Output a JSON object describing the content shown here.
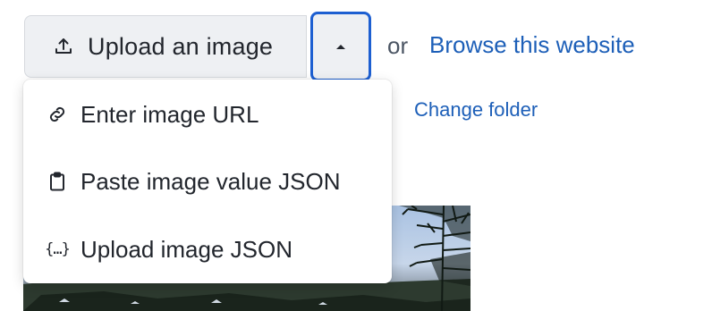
{
  "toolbar": {
    "upload_label": "Upload an image",
    "upload_icon": "upload-icon",
    "toggle_icon": "caret-up-icon",
    "or_text": "or",
    "browse_label": "Browse this website",
    "change_folder_label": "Change folder"
  },
  "menu": {
    "items": [
      {
        "label": "Enter image URL",
        "icon": "link-icon"
      },
      {
        "label": "Paste image value JSON",
        "icon": "clipboard-icon"
      },
      {
        "label": "Upload image JSON",
        "icon": "json-braces-icon"
      }
    ]
  },
  "colors": {
    "accent": "#1d5fd1",
    "link": "#1d5fb8",
    "button_bg": "#eef0f3",
    "text": "#22262d"
  }
}
